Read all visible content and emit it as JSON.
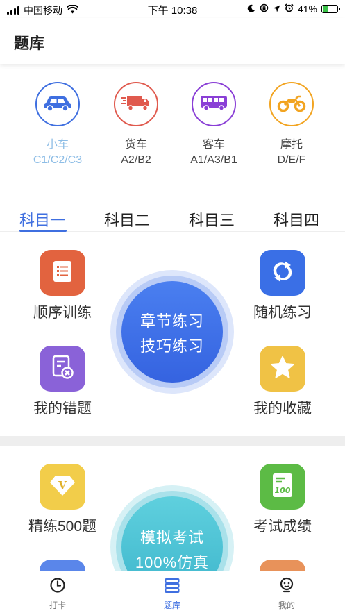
{
  "status_bar": {
    "carrier": "中国移动",
    "time": "下午 10:38",
    "battery": "41%",
    "battery_level": 0.41,
    "icons": [
      "signal-icon",
      "wifi-icon",
      "moon-icon",
      "lock-rotation-icon",
      "location-icon",
      "alarm-icon",
      "battery-icon"
    ]
  },
  "header": {
    "title": "题库"
  },
  "vehicles": [
    {
      "name": "小车",
      "code": "C1/C2/C3",
      "icon": "car-icon",
      "color": "#3f6fe0",
      "active": true
    },
    {
      "name": "货车",
      "code": "A2/B2",
      "icon": "truck-icon",
      "color": "#e05a4e",
      "active": false
    },
    {
      "name": "客车",
      "code": "A1/A3/B1",
      "icon": "bus-icon",
      "color": "#8a3fd6",
      "active": false
    },
    {
      "name": "摩托",
      "code": "D/E/F",
      "icon": "motorcycle-icon",
      "color": "#f2a421",
      "active": false
    }
  ],
  "subject_tabs": [
    {
      "label": "科目一",
      "active": true
    },
    {
      "label": "科目二",
      "active": false
    },
    {
      "label": "科目三",
      "active": false
    },
    {
      "label": "科目四",
      "active": false
    }
  ],
  "practice": {
    "sequential": {
      "label": "顺序训练",
      "icon": "list-icon",
      "color": "#e2633f"
    },
    "random": {
      "label": "随机练习",
      "icon": "shuffle-icon",
      "color": "#3a6fe6"
    },
    "mistakes": {
      "label": "我的错题",
      "icon": "wrong-doc-icon",
      "color": "#8a62d8"
    },
    "favorites": {
      "label": "我的收藏",
      "icon": "star-icon",
      "color": "#f0c245"
    },
    "center": {
      "line1": "章节练习",
      "line2": "技巧练习",
      "color": "#3a6fe6"
    }
  },
  "exam": {
    "refined": {
      "label": "精练500题",
      "icon": "v-diamond-icon",
      "color": "#f2cd4a"
    },
    "scores": {
      "label": "考试成绩",
      "icon": "score-100-icon",
      "color": "#5cbb45"
    },
    "center": {
      "line1": "模拟考试",
      "line2": "100%仿真",
      "color": "#4cc3d6"
    }
  },
  "tab_bar": [
    {
      "label": "打卡",
      "icon": "clock-icon",
      "active": false
    },
    {
      "label": "题库",
      "icon": "stack-icon",
      "active": true
    },
    {
      "label": "我的",
      "icon": "profile-face-icon",
      "active": false
    }
  ],
  "colors": {
    "accent": "#3f6fe0",
    "active_vehicle_text": "#8dbde6"
  }
}
